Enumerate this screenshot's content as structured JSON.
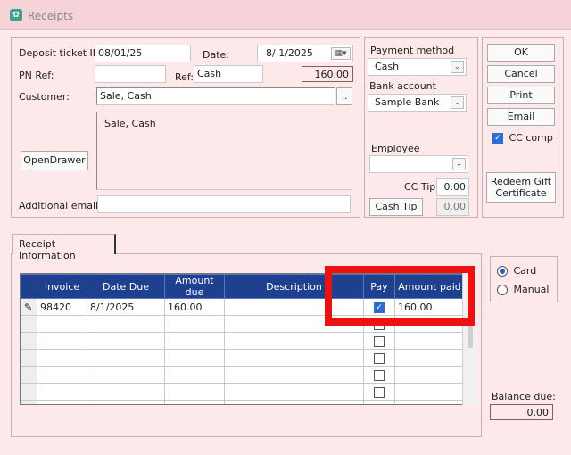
{
  "window": {
    "title": "Receipts"
  },
  "header": {
    "deposit_ticket_label": "Deposit ticket ID",
    "deposit_ticket_value": "08/01/25",
    "date_label": "Date:",
    "date_value": "8/ 1/2025",
    "pn_ref_label": "PN Ref:",
    "pn_ref_value": "",
    "ref_label": "Ref:",
    "ref_value": "Cash",
    "total_value": "160.00",
    "customer_label": "Customer:",
    "customer_value": "Sale, Cash",
    "customer_lookup_label": "..",
    "address_text": "Sale, Cash",
    "open_drawer_label": "OpenDrawer",
    "additional_email_label": "Additional email",
    "additional_email_value": ""
  },
  "payment": {
    "method_label": "Payment method",
    "method_value": "Cash",
    "bank_label": "Bank account",
    "bank_value": "Sample Bank",
    "employee_label": "Employee",
    "employee_value": "",
    "cc_tip_label": "CC Tip",
    "cc_tip_value": "0.00",
    "cash_tip_label": "Cash Tip",
    "cash_tip_value": "0.00"
  },
  "actions": {
    "ok": "OK",
    "cancel": "Cancel",
    "print": "Print",
    "email": "Email",
    "cc_comp_label": "CC comp",
    "cc_comp_checked": true,
    "redeem": "Redeem Gift Certificate"
  },
  "receipt_info": {
    "tab_label": "Receipt Information",
    "columns": [
      "Invoice",
      "Date Due",
      "Amount due",
      "Description",
      "Pay",
      "Amount paid"
    ],
    "rows": [
      {
        "invoice": "98420",
        "date_due": "8/1/2025",
        "amount_due": "160.00",
        "description": "",
        "pay": true,
        "amount_paid": "160.00"
      },
      {
        "invoice": "",
        "date_due": "",
        "amount_due": "",
        "description": "",
        "pay": false,
        "amount_paid": ""
      },
      {
        "invoice": "",
        "date_due": "",
        "amount_due": "",
        "description": "",
        "pay": false,
        "amount_paid": ""
      },
      {
        "invoice": "",
        "date_due": "",
        "amount_due": "",
        "description": "",
        "pay": false,
        "amount_paid": ""
      },
      {
        "invoice": "",
        "date_due": "",
        "amount_due": "",
        "description": "",
        "pay": false,
        "amount_paid": ""
      },
      {
        "invoice": "",
        "date_due": "",
        "amount_due": "",
        "description": "",
        "pay": false,
        "amount_paid": ""
      },
      {
        "invoice": "",
        "date_due": "",
        "amount_due": "",
        "description": "",
        "pay": false,
        "amount_paid": ""
      }
    ]
  },
  "mode": {
    "card_label": "Card",
    "manual_label": "Manual",
    "selected": "Card"
  },
  "balance": {
    "label": "Balance due:",
    "value": "0.00"
  },
  "colors": {
    "highlight": "#ee1111",
    "grid_header": "#1f3f8f",
    "background": "#fde8ea"
  }
}
